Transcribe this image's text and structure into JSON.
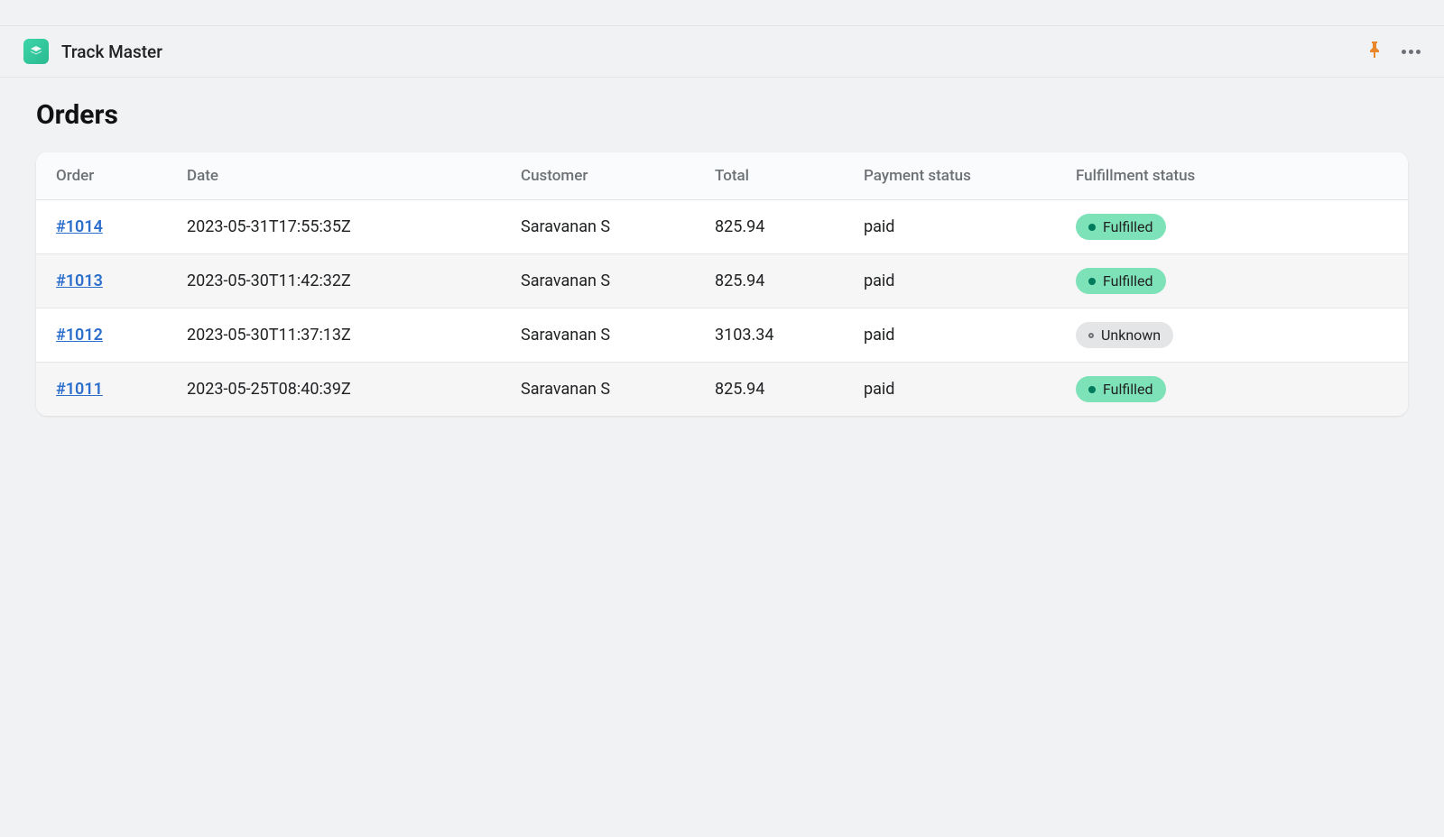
{
  "header": {
    "appTitle": "Track Master"
  },
  "page": {
    "title": "Orders"
  },
  "table": {
    "columns": {
      "order": "Order",
      "date": "Date",
      "customer": "Customer",
      "total": "Total",
      "paymentStatus": "Payment status",
      "fulfillmentStatus": "Fulfillment status"
    }
  },
  "orders": [
    {
      "id": "#1014",
      "date": "2023-05-31T17:55:35Z",
      "customer": "Saravanan S",
      "total": "825.94",
      "paymentStatus": "paid",
      "fulfillmentStatus": "Fulfilled",
      "fulfillmentType": "fulfilled"
    },
    {
      "id": "#1013",
      "date": "2023-05-30T11:42:32Z",
      "customer": "Saravanan S",
      "total": "825.94",
      "paymentStatus": "paid",
      "fulfillmentStatus": "Fulfilled",
      "fulfillmentType": "fulfilled"
    },
    {
      "id": "#1012",
      "date": "2023-05-30T11:37:13Z",
      "customer": "Saravanan S",
      "total": "3103.34",
      "paymentStatus": "paid",
      "fulfillmentStatus": "Unknown",
      "fulfillmentType": "unknown"
    },
    {
      "id": "#1011",
      "date": "2023-05-25T08:40:39Z",
      "customer": "Saravanan S",
      "total": "825.94",
      "paymentStatus": "paid",
      "fulfillmentStatus": "Fulfilled",
      "fulfillmentType": "fulfilled"
    }
  ]
}
